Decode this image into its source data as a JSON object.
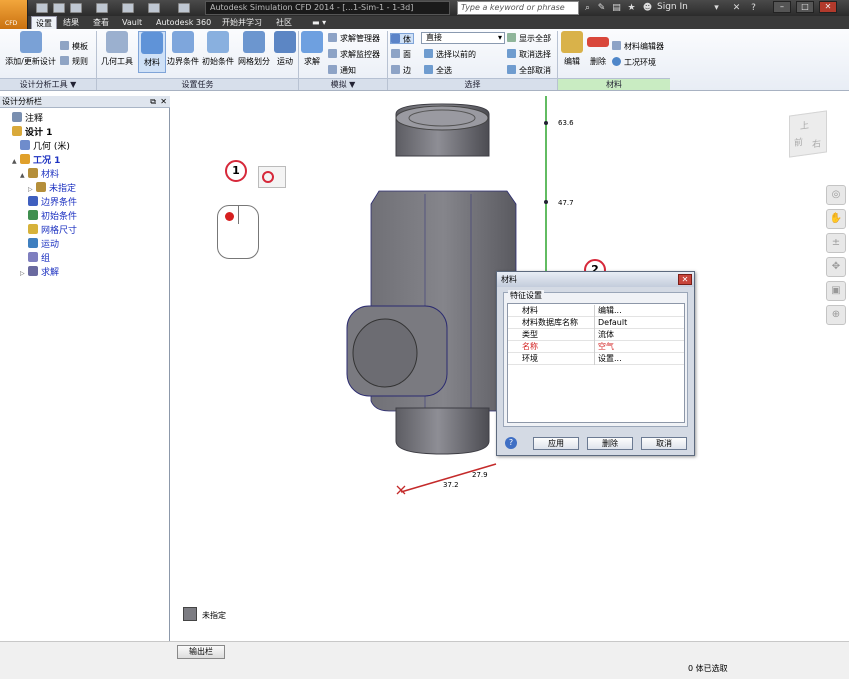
{
  "app": {
    "logo_text": "CFD",
    "doc_title": "Autodesk Simulation CFD 2014 - [...1-Sim-1 - 1-3d]",
    "search_placeholder": "Type a keyword or phrase",
    "sign_in": "Sign In"
  },
  "tabs": [
    "设置",
    "结果",
    "查看",
    "Vault",
    "Autodesk 360",
    "开始并学习",
    "社区"
  ],
  "ribbon": {
    "design_study": {
      "update": "添加/更新设计",
      "template": "模板",
      "rules": "规则",
      "footer": "设计分析工具 ▼"
    },
    "setup": {
      "geometry": "几何工具",
      "material": "材料",
      "boundary": "边界条件",
      "initial": "初始条件",
      "mesh": "网格划分",
      "motion": "运动",
      "footer": "设置任务"
    },
    "simulate": {
      "solve": "求解",
      "solver_manager": "求解管理器",
      "solver_monitor": "求解监控器",
      "notify": "通知",
      "footer": "模拟 ▼"
    },
    "select": {
      "volume": "体",
      "surface": "面",
      "edge": "边",
      "mode": "直接",
      "prev": "选择以前的",
      "all": "全选",
      "show_all": "显示全部",
      "deselect": "取消选择",
      "cancel_all": "全部取消",
      "footer": "选择"
    },
    "materials": {
      "edit": "编辑",
      "remove": "删除",
      "editor": "材料编辑器",
      "env": "工况环境",
      "footer": "材料"
    }
  },
  "panel": {
    "title": "设计分析栏",
    "tree": [
      {
        "label": "注释",
        "level": 0,
        "color": "",
        "bold": false,
        "exp": "",
        "icon": "#7a8fb0"
      },
      {
        "label": "设计 1",
        "level": 0,
        "color": "",
        "bold": true,
        "exp": "",
        "icon": "#d9a93a"
      },
      {
        "label": "几何 (米)",
        "level": 1,
        "color": "",
        "bold": false,
        "exp": "",
        "icon": "#6f8ccc"
      },
      {
        "label": "工况 1",
        "level": 1,
        "color": "blue",
        "bold": true,
        "exp": "▲",
        "icon": "#e0a02a"
      },
      {
        "label": "材料",
        "level": 2,
        "color": "blue",
        "bold": false,
        "exp": "▲",
        "icon": "#b58f3a"
      },
      {
        "label": "未指定",
        "level": 3,
        "color": "blue",
        "bold": false,
        "exp": "▷",
        "icon": "#b58f3a"
      },
      {
        "label": "边界条件",
        "level": 2,
        "color": "blue",
        "bold": false,
        "exp": "",
        "icon": "#3f5fbf"
      },
      {
        "label": "初始条件",
        "level": 2,
        "color": "blue",
        "bold": false,
        "exp": "",
        "icon": "#3f8f4f"
      },
      {
        "label": "网格尺寸",
        "level": 2,
        "color": "blue",
        "bold": false,
        "exp": "",
        "icon": "#d6b23a"
      },
      {
        "label": "运动",
        "level": 2,
        "color": "blue",
        "bold": false,
        "exp": "",
        "icon": "#3f7fbf"
      },
      {
        "label": "组",
        "level": 2,
        "color": "blue",
        "bold": false,
        "exp": "",
        "icon": "#7f7fbf"
      },
      {
        "label": "求解",
        "level": 2,
        "color": "blue",
        "bold": false,
        "exp": "▷",
        "icon": "#6a6a9f"
      }
    ]
  },
  "viewport": {
    "dim_y1": "63.6",
    "dim_y2": "47.7",
    "dim_x1": "27.9",
    "dim_x2": "37.2",
    "legend": "未指定",
    "callout1": "1",
    "callout2": "2",
    "viewcube": [
      "上",
      "前",
      "右"
    ]
  },
  "dialog": {
    "title": "材料",
    "group": "特征设置",
    "rows": [
      {
        "key": "材料",
        "value": "编辑..."
      },
      {
        "key": "材料数据库名称",
        "value": "Default"
      },
      {
        "key": "类型",
        "value": "流体"
      },
      {
        "key": "名称",
        "value": "空气",
        "red": true
      },
      {
        "key": "环境",
        "value": "设置..."
      }
    ],
    "apply": "应用",
    "remove": "删除",
    "cancel": "取消"
  },
  "status": {
    "output": "输出栏",
    "selected": "0 体已选取"
  }
}
